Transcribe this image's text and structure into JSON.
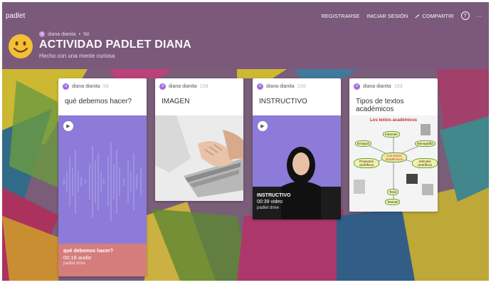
{
  "app": {
    "brand": "padlet"
  },
  "nav": {
    "register": "REGISTRARSE",
    "login": "INICIAR SESIÓN",
    "share": "COMPARTIR",
    "help": "?",
    "more": "···"
  },
  "board": {
    "author": "diana dianita",
    "author_initial": "d",
    "age": "5d",
    "title": "ACTIVIDAD PADLET DIANA",
    "subtitle": "Hecho con una mente curiosa"
  },
  "cards": [
    {
      "author": "diana dianita",
      "initial": "d",
      "age": "9d",
      "title": "qué debemos hacer?",
      "attachment": {
        "type": "audio",
        "title": "qué debemos hacer?",
        "duration": "00:18 audio",
        "source": "padlet drive",
        "color": "#8c7bd8",
        "caption_color": "#d57d7d"
      }
    },
    {
      "author": "diana dianita",
      "initial": "d",
      "age": "10d",
      "title": "IMAGEN",
      "attachment": {
        "type": "image"
      }
    },
    {
      "author": "diana dianita",
      "initial": "d",
      "age": "10d",
      "title": "INSTRUCTIVO",
      "attachment": {
        "type": "video",
        "title": "INSTRUCTIVO",
        "duration": "00:39 video",
        "source": "padlet drive"
      }
    },
    {
      "author": "diana dianita",
      "initial": "d",
      "age": "10d",
      "title": "Tipos de textos académicos",
      "attachment": {
        "type": "image",
        "diagram_title": "Los textos académicos",
        "nodes": [
          "Informes",
          "Ensayos",
          "Monografía",
          "Los textos académicos",
          "Proyectos científicos",
          "Artículos científicos",
          "Tesis",
          "Tesinas"
        ]
      }
    }
  ],
  "colors": {
    "header": "#7c597c",
    "accent": "#a56be0"
  }
}
